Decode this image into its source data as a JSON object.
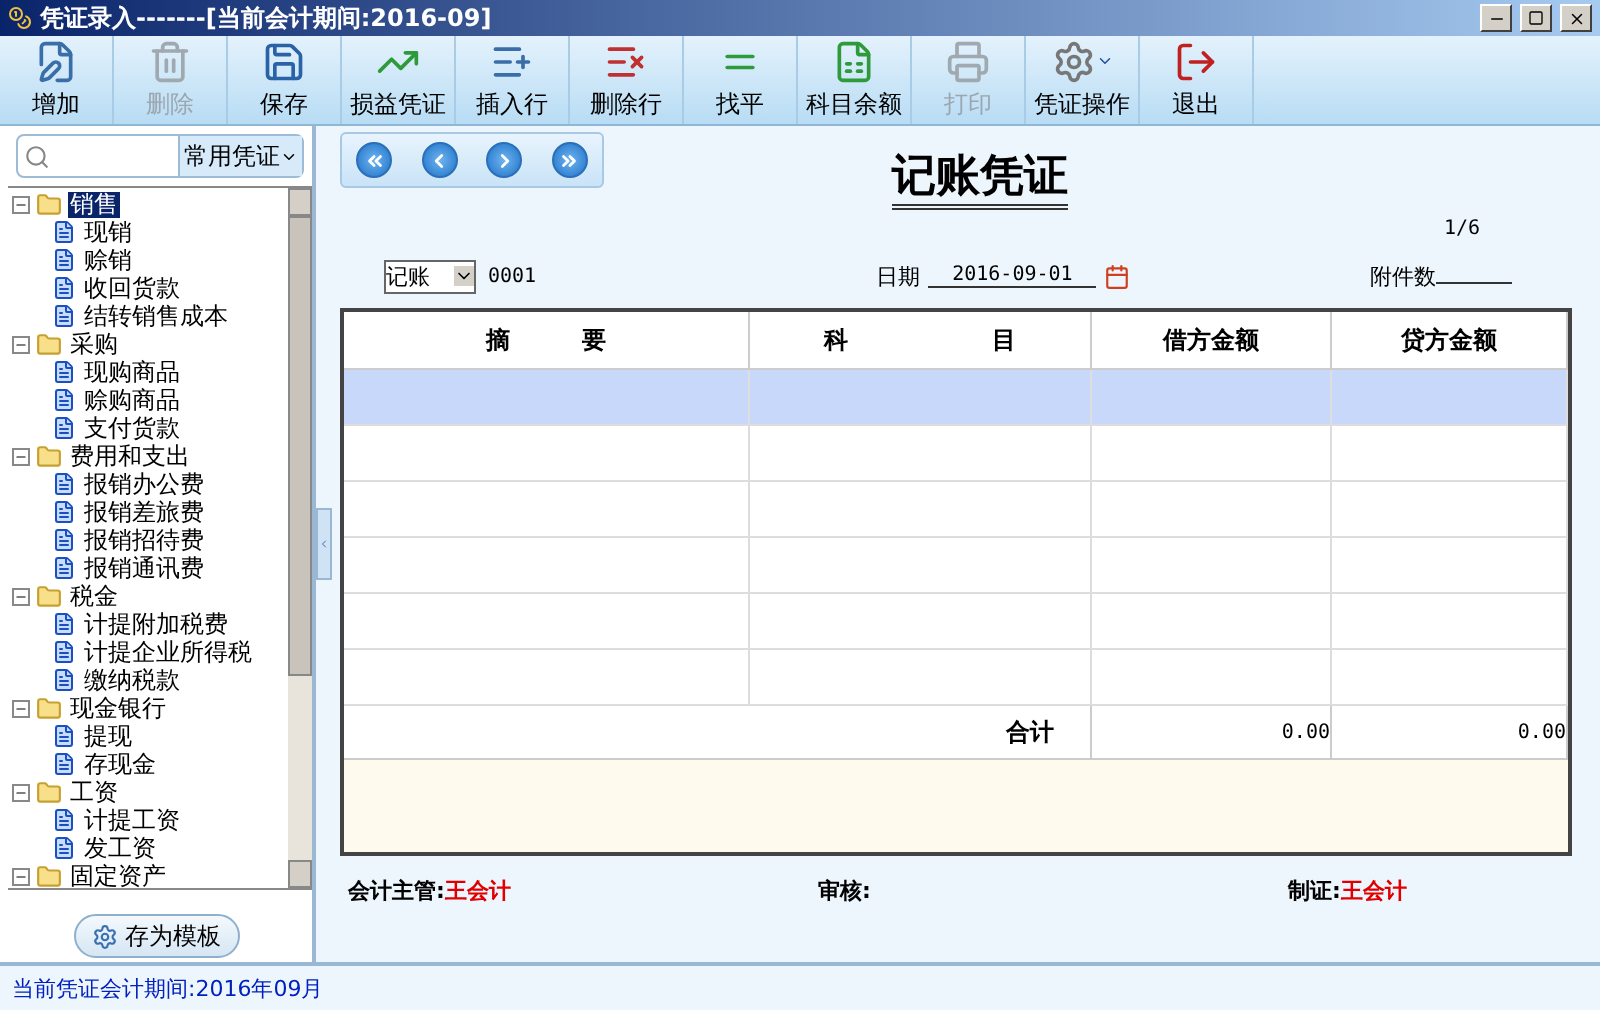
{
  "window": {
    "title": "凭证录入-------[当前会计期间:2016-09]"
  },
  "toolbar": [
    {
      "label": "增加",
      "disabled": false,
      "dropdown": false
    },
    {
      "label": "删除",
      "disabled": true,
      "dropdown": false
    },
    {
      "label": "保存",
      "disabled": false,
      "dropdown": false
    },
    {
      "label": "损益凭证",
      "disabled": false,
      "dropdown": false
    },
    {
      "label": "插入行",
      "disabled": false,
      "dropdown": false
    },
    {
      "label": "删除行",
      "disabled": false,
      "dropdown": false
    },
    {
      "label": "找平",
      "disabled": false,
      "dropdown": false
    },
    {
      "label": "科目余额",
      "disabled": false,
      "dropdown": false
    },
    {
      "label": "打印",
      "disabled": true,
      "dropdown": false
    },
    {
      "label": "凭证操作",
      "disabled": false,
      "dropdown": true
    },
    {
      "label": "退出",
      "disabled": false,
      "dropdown": false
    }
  ],
  "sidebar": {
    "filter": "常用凭证",
    "tree": [
      {
        "label": "销售",
        "selected": true,
        "children": [
          {
            "label": "现销",
            "selected": false
          },
          {
            "label": "赊销",
            "selected": false
          },
          {
            "label": "收回货款",
            "selected": false
          },
          {
            "label": "结转销售成本",
            "selected": false
          }
        ]
      },
      {
        "label": "采购",
        "selected": false,
        "children": [
          {
            "label": "现购商品",
            "selected": false
          },
          {
            "label": "赊购商品",
            "selected": false
          },
          {
            "label": "支付货款",
            "selected": false
          }
        ]
      },
      {
        "label": "费用和支出",
        "selected": false,
        "children": [
          {
            "label": "报销办公费",
            "selected": false
          },
          {
            "label": "报销差旅费",
            "selected": false
          },
          {
            "label": "报销招待费",
            "selected": false
          },
          {
            "label": "报销通讯费",
            "selected": false
          }
        ]
      },
      {
        "label": "税金",
        "selected": false,
        "children": [
          {
            "label": "计提附加税费",
            "selected": false
          },
          {
            "label": "计提企业所得税",
            "selected": false
          },
          {
            "label": "缴纳税款",
            "selected": false
          }
        ]
      },
      {
        "label": "现金银行",
        "selected": false,
        "children": [
          {
            "label": "提现",
            "selected": false
          },
          {
            "label": "存现金",
            "selected": false
          }
        ]
      },
      {
        "label": "工资",
        "selected": false,
        "children": [
          {
            "label": "计提工资",
            "selected": false
          },
          {
            "label": "发工资",
            "selected": false
          }
        ]
      },
      {
        "label": "固定资产",
        "selected": false
      }
    ],
    "save_template": "存为模板"
  },
  "voucher": {
    "title": "记账凭证",
    "page": "1/6",
    "type": "记账",
    "number": "0001",
    "date_label": "日期",
    "date": "2016-09-01",
    "attachments_label": "附件数",
    "columns": [
      "摘　　　要",
      "科　　　　　　目",
      "借方金额",
      "贷方金额"
    ],
    "rows": [
      {
        "selected": true
      },
      {
        "selected": false
      },
      {
        "selected": false
      },
      {
        "selected": false
      },
      {
        "selected": false
      },
      {
        "selected": false
      }
    ],
    "total_label": "合计",
    "total_debit": "0.00",
    "total_credit": "0.00",
    "signatures": [
      {
        "label": "会计主管:",
        "name": "王会计"
      },
      {
        "label": "审核:"
      },
      {
        "label": "制证:",
        "name": "王会计"
      }
    ]
  },
  "status_bar": "当前凭证会计期间:2016年09月"
}
